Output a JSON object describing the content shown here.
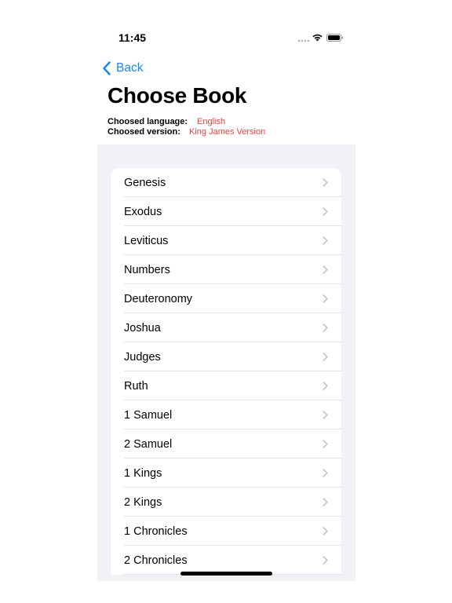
{
  "status_bar": {
    "time": "11:45"
  },
  "nav": {
    "back_label": "Back"
  },
  "page": {
    "title": "Choose Book"
  },
  "selection": {
    "language_label": "Choosed language:",
    "language_value": "English",
    "version_label": "Choosed version:",
    "version_value": "King James Version"
  },
  "books": [
    {
      "label": "Genesis"
    },
    {
      "label": "Exodus"
    },
    {
      "label": "Leviticus"
    },
    {
      "label": "Numbers"
    },
    {
      "label": "Deuteronomy"
    },
    {
      "label": "Joshua"
    },
    {
      "label": "Judges"
    },
    {
      "label": "Ruth"
    },
    {
      "label": "1 Samuel"
    },
    {
      "label": "2 Samuel"
    },
    {
      "label": "1 Kings"
    },
    {
      "label": "2 Kings"
    },
    {
      "label": "1 Chronicles"
    },
    {
      "label": "2 Chronicles"
    }
  ],
  "colors": {
    "accent": "#1a84f2",
    "value_red": "#e8413c",
    "grouped_background": "#f1f1f6",
    "chevron": "#c4c4c8"
  },
  "icons": {
    "back": "chevron-left-icon",
    "row": "chevron-right-icon",
    "wifi": "wifi-icon",
    "battery": "battery-icon",
    "signal": "cellular-signal-icon"
  }
}
